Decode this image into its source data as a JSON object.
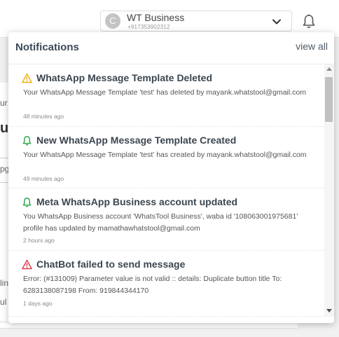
{
  "account": {
    "avatar_letter": "C",
    "name": "WT Business",
    "phone": "+917353902312"
  },
  "background": {
    "frag1": "ur",
    "frag2": "u",
    "frag3": "pg",
    "frag4": "lin",
    "frag5": "ul"
  },
  "notifications_panel": {
    "title": "Notifications",
    "view_all": "view all",
    "items": [
      {
        "icon": "warning-triangle-icon",
        "icon_color": "#f0ad00",
        "title": "WhatsApp Message Template Deleted",
        "body": "Your WhatsApp Message Template 'test' has deleted by mayank.whatstool@gmail.com",
        "time": "48 minutes ago"
      },
      {
        "icon": "bell-icon",
        "icon_color": "#28a745",
        "title": "New WhatsApp Message Template Created",
        "body": "Your WhatsApp Message Template 'test' has created by mayank.whatstool@gmail.com",
        "time": "49 minutes ago"
      },
      {
        "icon": "bell-icon",
        "icon_color": "#28a745",
        "title": "Meta WhatsApp Business account updated",
        "body": "You WhatsApp Business account 'WhatsTool Business', waba id '108063001975681' profile has updated by mamathawhatstool@gmail.com",
        "time": "2 hours ago"
      },
      {
        "icon": "warning-triangle-icon",
        "icon_color": "#dc3545",
        "title": "ChatBot failed to send message",
        "body": "Error: (#131009) Parameter value is not valid :: details: Duplicate button title To: 6283138087198 From: 919844344170",
        "time": "1 days ago"
      }
    ]
  },
  "colors": {
    "warning": "#f0ad00",
    "success": "#28a745",
    "danger": "#dc3545",
    "title_text": "#3a4a58"
  }
}
